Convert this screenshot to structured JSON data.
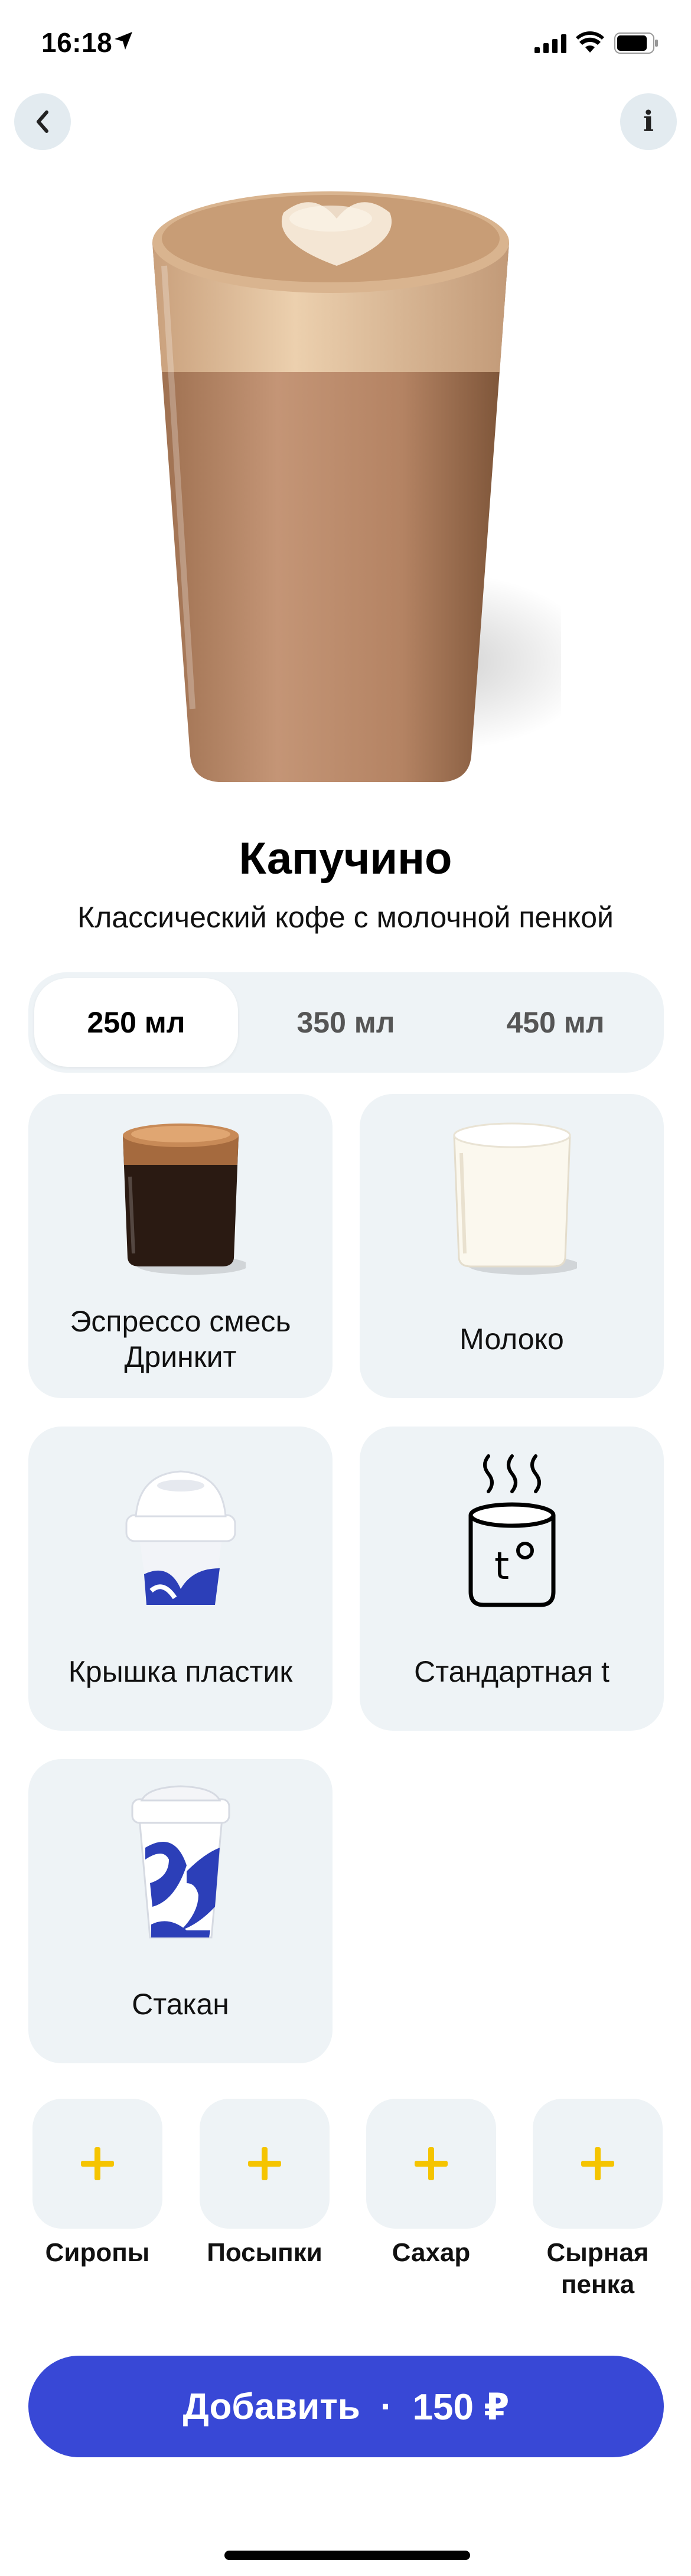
{
  "status_bar": {
    "time": "16:18",
    "icons": [
      "location-arrow-icon",
      "cellular-signal-icon",
      "wifi-icon",
      "battery-icon"
    ]
  },
  "header": {
    "back_icon": "chevron-left-icon",
    "info_label": "i"
  },
  "product": {
    "title": "Капучино",
    "subtitle": "Классический кофе с молочной пенкой"
  },
  "sizes": [
    {
      "label": "250 мл",
      "selected": true
    },
    {
      "label": "350 мл",
      "selected": false
    },
    {
      "label": "450 мл",
      "selected": false
    }
  ],
  "ingredients": [
    {
      "label": "Эспрессо смесь Дринкит",
      "icon": "espresso-glass-icon"
    },
    {
      "label": "Молоко",
      "icon": "milk-glass-icon"
    },
    {
      "label": "Крышка пластик",
      "icon": "plastic-lid-icon"
    },
    {
      "label": "Стандартная t",
      "icon": "hot-cup-temperature-icon"
    },
    {
      "label": "Стакан",
      "icon": "paper-cup-icon"
    }
  ],
  "addons": [
    {
      "label": "Сиропы"
    },
    {
      "label": "Посыпки"
    },
    {
      "label": "Сахар"
    },
    {
      "label": "Сырная пенка"
    }
  ],
  "add_button": {
    "label": "Добавить",
    "separator": "·",
    "price": "150 ₽"
  },
  "colors": {
    "accent": "#3848d6",
    "plus": "#f5c400",
    "card_bg": "#eef3f6",
    "button_bg": "#e3ebf0"
  }
}
